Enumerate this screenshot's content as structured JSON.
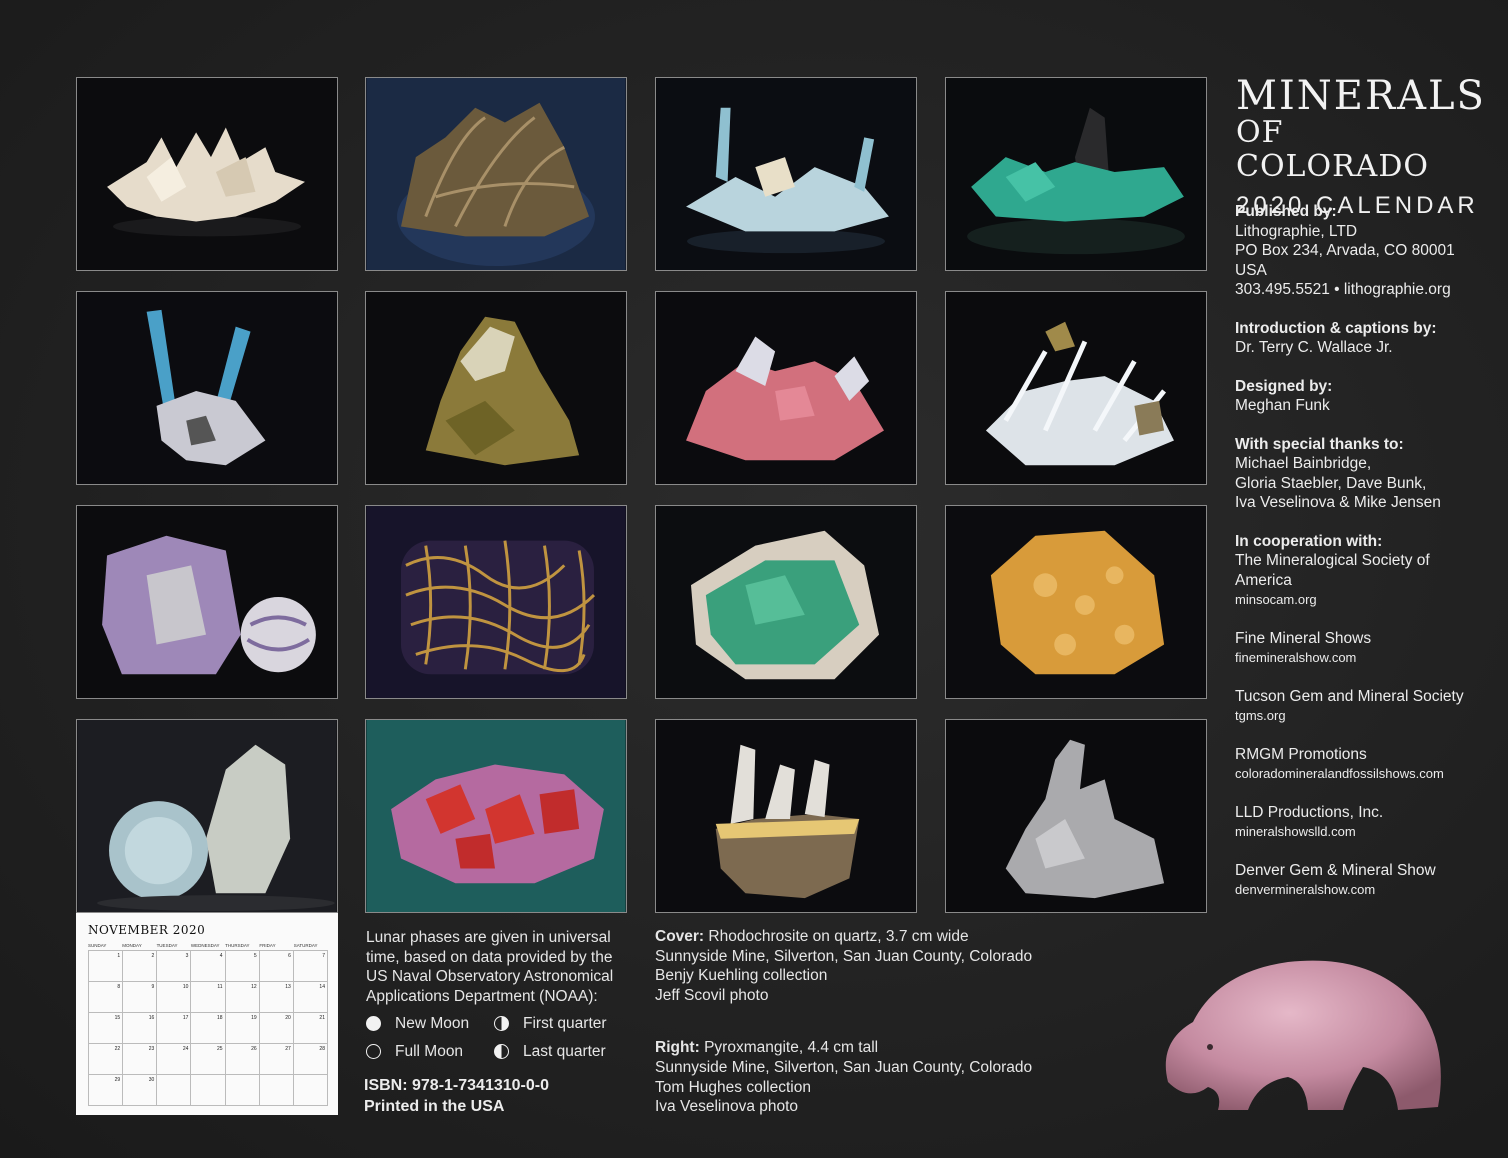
{
  "title": {
    "line1": "MINERALS",
    "line2": "OF COLORADO",
    "line3": "2020 CALENDAR"
  },
  "credits": {
    "published": {
      "heading": "Published by:",
      "lines": [
        "Lithographie, LTD",
        "PO Box 234, Arvada, CO 80001",
        "USA",
        "303.495.5521  •  lithographie.org"
      ]
    },
    "introduction": {
      "heading": "Introduction & captions by:",
      "lines": [
        "Dr. Terry C. Wallace Jr."
      ]
    },
    "designed": {
      "heading": "Designed by:",
      "lines": [
        "Meghan Funk"
      ]
    },
    "thanks": {
      "heading": "With special thanks to:",
      "lines": [
        "Michael Bainbridge,",
        "Gloria Staebler, Dave Bunk,",
        "Iva Veselinova & Mike Jensen"
      ]
    },
    "cooperation": {
      "heading": "In cooperation with:",
      "lines": [
        "The Mineralogical Society of",
        "America"
      ],
      "url": "minsocam.org"
    },
    "orgs": [
      {
        "name": "Fine Mineral Shows",
        "url": "finemineralshow.com"
      },
      {
        "name": "Tucson Gem and Mineral Society",
        "url": "tgms.org"
      },
      {
        "name": "RMGM Promotions",
        "url": "coloradomineralandfossilshows.com"
      },
      {
        "name": "LLD Productions, Inc.",
        "url": "mineralshowslld.com"
      },
      {
        "name": "Denver Gem & Mineral Show",
        "url": "denvermineralshow.com"
      }
    ]
  },
  "calendar_thumb": {
    "month": "NOVEMBER",
    "year": "2020",
    "weekdays": [
      "SUNDAY",
      "MONDAY",
      "TUESDAY",
      "WEDNESDAY",
      "THURSDAY",
      "FRIDAY",
      "SATURDAY"
    ],
    "days": [
      "1",
      "2",
      "3",
      "4",
      "5",
      "6",
      "7",
      "8",
      "9",
      "10",
      "11",
      "12",
      "13",
      "14",
      "15",
      "16",
      "17",
      "18",
      "19",
      "20",
      "21",
      "22",
      "23",
      "24",
      "25",
      "26",
      "27",
      "28",
      "29",
      "30",
      "",
      "",
      "",
      "",
      ""
    ]
  },
  "lunar": {
    "text": "Lunar phases are given in universal time, based on data provided by the US Naval Observatory Astronomical Applications Department (NOAA):",
    "new_moon": "New Moon",
    "first_quarter": "First quarter",
    "full_moon": "Full Moon",
    "last_quarter": "Last quarter"
  },
  "isbn": "ISBN: 978-1-7341310-0-0",
  "printed": "Printed in the USA",
  "captions": {
    "cover_label": "Cover:",
    "cover_desc": "Rhodochrosite on quartz, 3.7 cm wide",
    "cover_lines": [
      "Sunnyside Mine, Silverton, San Juan County, Colorado",
      "Benjy Kuehling collection",
      "Jeff Scovil photo"
    ],
    "right_label": "Right:",
    "right_desc": "Pyroxmangite, 4.4 cm tall",
    "right_lines": [
      "Sunnyside Mine, Silverton, San Juan County, Colorado",
      "Tom Hughes collection",
      "Iva Veselinova photo"
    ]
  },
  "colors": {
    "background": "#242424",
    "text": "#e8e8e8"
  }
}
